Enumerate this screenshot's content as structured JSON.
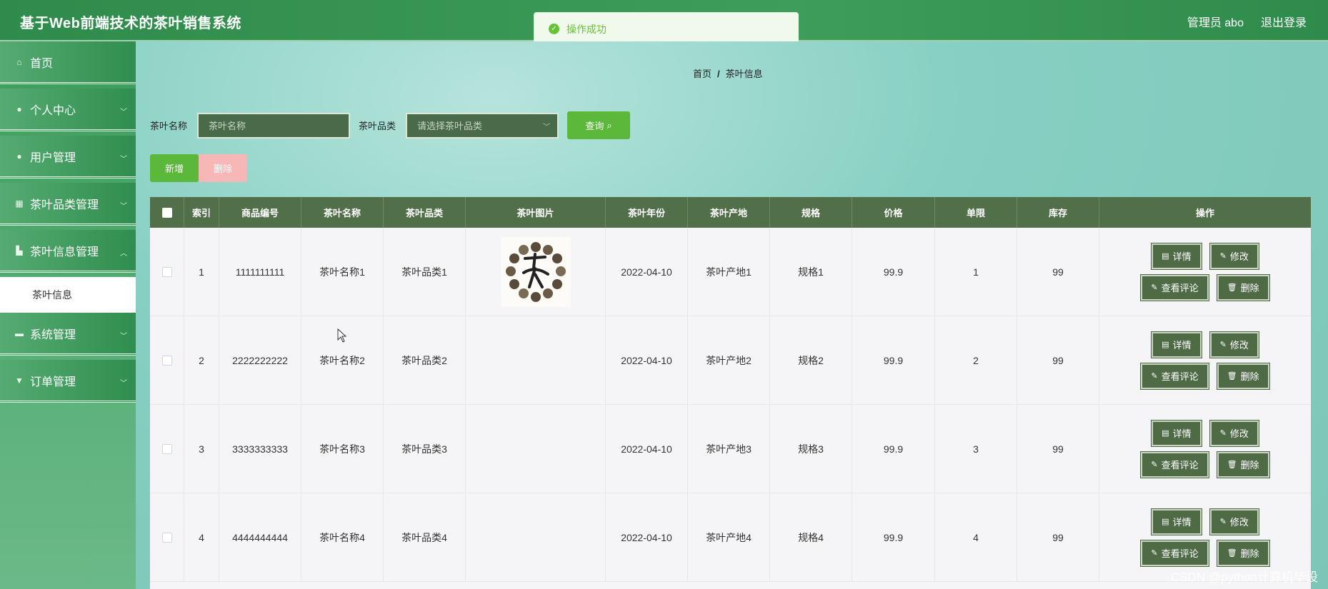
{
  "header": {
    "title": "基于Web前端技术的茶叶销售系统",
    "admin": "管理员 abo",
    "logout": "退出登录"
  },
  "toast": {
    "message": "操作成功"
  },
  "sidebar": {
    "items": [
      {
        "label": "首页",
        "icon": "home-icon"
      },
      {
        "label": "个人中心",
        "icon": "user-icon"
      },
      {
        "label": "用户管理",
        "icon": "pin-icon"
      },
      {
        "label": "茶叶品类管理",
        "icon": "grid-icon"
      },
      {
        "label": "茶叶信息管理",
        "icon": "thumb-icon"
      },
      {
        "label": "茶叶信息",
        "icon": ""
      },
      {
        "label": "系统管理",
        "icon": "box-icon"
      },
      {
        "label": "订单管理",
        "icon": "cup-icon"
      }
    ]
  },
  "breadcrumb": {
    "home": "首页",
    "sep": "/",
    "current": "茶叶信息"
  },
  "search": {
    "name_label": "茶叶名称",
    "name_placeholder": "茶叶名称",
    "category_label": "茶叶品类",
    "category_placeholder": "请选择茶叶品类",
    "query": "查询"
  },
  "actions": {
    "add": "新增",
    "delete": "删除"
  },
  "table": {
    "headers": [
      "索引",
      "商品编号",
      "茶叶名称",
      "茶叶品类",
      "茶叶图片",
      "茶叶年份",
      "茶叶产地",
      "规格",
      "价格",
      "单限",
      "库存",
      "操作"
    ],
    "ops": {
      "detail": "详情",
      "edit": "修改",
      "comments": "查看评论",
      "remove": "删除"
    },
    "rows": [
      {
        "index": "1",
        "code": "1111111111",
        "name": "茶叶名称1",
        "category": "茶叶品类1",
        "image": true,
        "year": "2022-04-10",
        "origin": "茶叶产地1",
        "spec": "规格1",
        "price": "99.9",
        "limit": "1",
        "stock": "99"
      },
      {
        "index": "2",
        "code": "2222222222",
        "name": "茶叶名称2",
        "category": "茶叶品类2",
        "image": false,
        "year": "2022-04-10",
        "origin": "茶叶产地2",
        "spec": "规格2",
        "price": "99.9",
        "limit": "2",
        "stock": "99"
      },
      {
        "index": "3",
        "code": "3333333333",
        "name": "茶叶名称3",
        "category": "茶叶品类3",
        "image": false,
        "year": "2022-04-10",
        "origin": "茶叶产地3",
        "spec": "规格3",
        "price": "99.9",
        "limit": "3",
        "stock": "99"
      },
      {
        "index": "4",
        "code": "4444444444",
        "name": "茶叶名称4",
        "category": "茶叶品类4",
        "image": false,
        "year": "2022-04-10",
        "origin": "茶叶产地4",
        "spec": "规格4",
        "price": "99.9",
        "limit": "4",
        "stock": "99"
      }
    ]
  },
  "watermark": "CSDN @python计算机毕设",
  "colors": {
    "header": "#2f8b4b",
    "table_header": "#516f49",
    "primary": "#5cb83a",
    "op_button": "#4e6b46",
    "danger_light": "#f7b7b7"
  }
}
